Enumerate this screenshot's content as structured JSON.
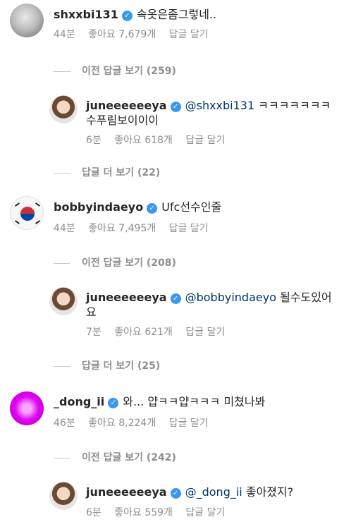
{
  "comments": [
    {
      "username": "shxxbi131",
      "text": "속옷은좀그렇네..",
      "time": "44분",
      "likes": "좋아요 7,679개",
      "reply_label": "답글 달기",
      "view_previous": "이전 답글 보기 (259)",
      "reply": {
        "username": "juneeeeeeya",
        "mention": "@shxxbi131",
        "text_line1": "ㅋㅋㅋㅋㅋㅋㅋ",
        "text_line2": "수푸림보이이이",
        "time": "6분",
        "likes": "좋아요 618개",
        "reply_label": "답글 달기"
      },
      "view_more": "답글 더 보기 (22)"
    },
    {
      "username": "bobbyindaeyo",
      "text": "Ufc선수인줄",
      "time": "44분",
      "likes": "좋아요 7,495개",
      "reply_label": "답글 달기",
      "view_previous": "이전 답글 보기 (208)",
      "reply": {
        "username": "juneeeeeeya",
        "mention": "@bobbyindaeyo",
        "text_line1": "될수도있어",
        "text_line2": "요",
        "time": "7분",
        "likes": "좋아요 621개",
        "reply_label": "답글 달기"
      },
      "view_more": "답글 더 보기 (25)"
    },
    {
      "username": "_dong_ii",
      "text": "와... 얍ㅋㅋ얍ㅋㅋㅋ 미쳤나봐",
      "time": "46분",
      "likes": "좋아요 8,224개",
      "reply_label": "답글 달기",
      "view_previous": "이전 답글 보기 (242)",
      "reply": {
        "username": "juneeeeeeya",
        "mention": "@_dong_ii",
        "text_line1": "좋아졌지?",
        "time": "6분",
        "likes": "좋아요 559개",
        "reply_label": "답글 달기"
      }
    }
  ],
  "icons": {
    "verified": "verified-badge-icon",
    "verified_glyph": "✓"
  },
  "colors": {
    "verified": "#3897f0",
    "meta": "#8e8e8e",
    "mention": "#003569"
  }
}
